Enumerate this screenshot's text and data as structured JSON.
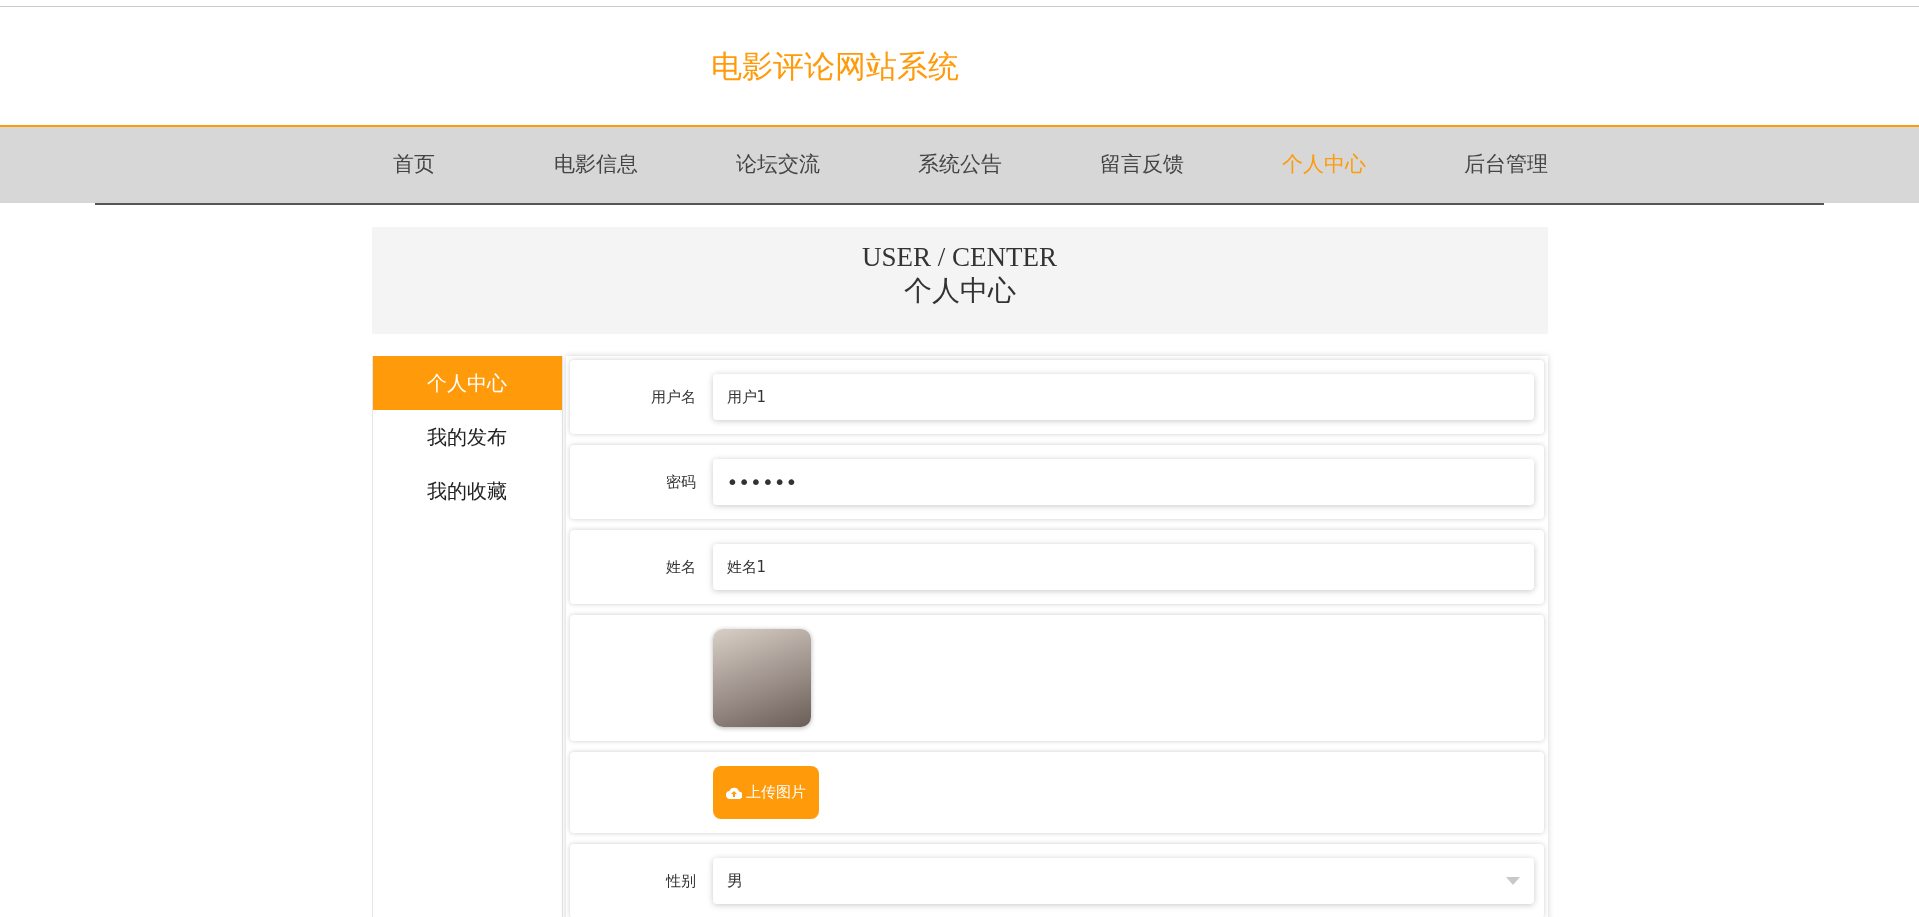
{
  "site_title": "电影评论网站系统",
  "nav": [
    {
      "label": "首页",
      "selected": false
    },
    {
      "label": "电影信息",
      "selected": false
    },
    {
      "label": "论坛交流",
      "selected": false
    },
    {
      "label": "系统公告",
      "selected": false
    },
    {
      "label": "留言反馈",
      "selected": false
    },
    {
      "label": "个人中心",
      "selected": true
    },
    {
      "label": "后台管理",
      "selected": false
    }
  ],
  "section_header": {
    "title_en": "USER / CENTER",
    "title_cn": "个人中心"
  },
  "sidebar": [
    {
      "label": "个人中心",
      "selected": true
    },
    {
      "label": "我的发布",
      "selected": false
    },
    {
      "label": "我的收藏",
      "selected": false
    }
  ],
  "form": [
    {
      "kind": "text",
      "label": "用户名",
      "value": "用户1"
    },
    {
      "kind": "password",
      "label": "密码",
      "value": "••••••"
    },
    {
      "kind": "text",
      "label": "姓名",
      "value": "姓名1"
    },
    {
      "kind": "image"
    },
    {
      "kind": "upload",
      "button": "上传图片"
    },
    {
      "kind": "select",
      "label": "性别",
      "value": "男"
    }
  ]
}
